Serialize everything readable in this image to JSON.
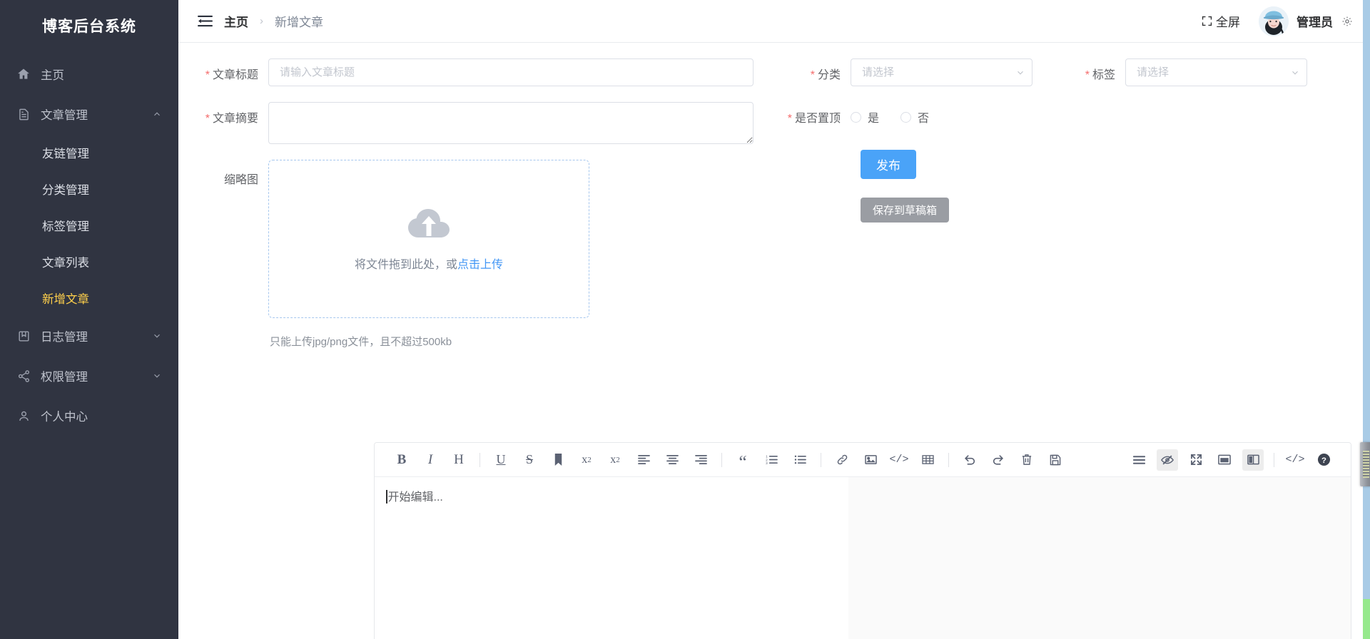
{
  "sidebar": {
    "brand": "博客后台系统",
    "items": [
      {
        "label": "主页",
        "icon": "home-icon",
        "arrow": ""
      },
      {
        "label": "文章管理",
        "icon": "document-icon",
        "arrow": "chevron-up-icon"
      },
      {
        "label": "日志管理",
        "icon": "book-icon",
        "arrow": "chevron-down-icon"
      },
      {
        "label": "权限管理",
        "icon": "share-icon",
        "arrow": "chevron-down-icon"
      },
      {
        "label": "个人中心",
        "icon": "user-icon",
        "arrow": ""
      }
    ],
    "submenu": [
      {
        "label": "友链管理",
        "active": false
      },
      {
        "label": "分类管理",
        "active": false
      },
      {
        "label": "标签管理",
        "active": false
      },
      {
        "label": "文章列表",
        "active": false
      },
      {
        "label": "新增文章",
        "active": true
      }
    ],
    "active_color": "#ffd04b",
    "background": "#303441"
  },
  "topbar": {
    "collapse_icon": "collapse-menu-icon",
    "breadcrumb_home": "主页",
    "breadcrumb_separator": "›",
    "breadcrumb_current": "新增文章",
    "fullscreen_label": "全屏",
    "fullscreen_icon": "fullscreen-icon",
    "username": "管理员",
    "gear_icon": "gear-icon",
    "avatar": "user-avatar"
  },
  "form": {
    "title": {
      "label": "文章标题",
      "required": true,
      "value": "",
      "placeholder": "请输入文章标题"
    },
    "summary": {
      "label": "文章摘要",
      "required": true,
      "value": "",
      "placeholder": ""
    },
    "category": {
      "label": "分类",
      "required": true,
      "value": "",
      "placeholder": "请选择",
      "arrow_icon": "chevron-down-icon"
    },
    "tag": {
      "label": "标签",
      "required": true,
      "value": "",
      "placeholder": "请选择",
      "arrow_icon": "chevron-down-icon"
    },
    "pin": {
      "label": "是否置顶",
      "required": true,
      "options": [
        {
          "label": "是",
          "checked": false
        },
        {
          "label": "否",
          "checked": false
        }
      ]
    },
    "thumbnail": {
      "label": "缩略图",
      "icon": "cloud-upload-icon",
      "drop_text": "将文件拖到此处，或",
      "link_text": "点击上传",
      "tip": "只能上传jpg/png文件，且不超过500kb"
    },
    "buttons": {
      "publish": "发布",
      "draft": "保存到草稿箱",
      "publish_color": "#4aa3f8",
      "draft_color": "#9a9da3"
    }
  },
  "editor": {
    "placeholder": "开始编辑...",
    "toolbar_left": [
      {
        "name": "bold-icon",
        "glyph": "B",
        "active": false,
        "sep_after": false
      },
      {
        "name": "italic-icon",
        "glyph": "I",
        "active": false,
        "sep_after": false
      },
      {
        "name": "heading-icon",
        "glyph": "H",
        "active": false,
        "sep_after": true
      },
      {
        "name": "underline-icon",
        "glyph": "U",
        "active": false,
        "sep_after": false
      },
      {
        "name": "strikethrough-icon",
        "glyph": "S",
        "active": false,
        "sep_after": false
      },
      {
        "name": "bookmark-icon",
        "glyph": "",
        "active": false,
        "sep_after": false
      },
      {
        "name": "superscript-icon",
        "glyph": "",
        "active": false,
        "sep_after": false
      },
      {
        "name": "subscript-icon",
        "glyph": "",
        "active": false,
        "sep_after": false
      },
      {
        "name": "align-left-icon",
        "glyph": "",
        "active": false,
        "sep_after": false
      },
      {
        "name": "align-center-icon",
        "glyph": "",
        "active": false,
        "sep_after": false
      },
      {
        "name": "align-right-icon",
        "glyph": "",
        "active": false,
        "sep_after": true
      },
      {
        "name": "quote-icon",
        "glyph": "",
        "active": false,
        "sep_after": false
      },
      {
        "name": "ordered-list-icon",
        "glyph": "",
        "active": false,
        "sep_after": false
      },
      {
        "name": "unordered-list-icon",
        "glyph": "",
        "active": false,
        "sep_after": true
      },
      {
        "name": "link-icon",
        "glyph": "",
        "active": false,
        "sep_after": false
      },
      {
        "name": "image-icon",
        "glyph": "",
        "active": false,
        "sep_after": false
      },
      {
        "name": "code-icon",
        "glyph": "",
        "active": false,
        "sep_after": false
      },
      {
        "name": "table-icon",
        "glyph": "",
        "active": false,
        "sep_after": true
      },
      {
        "name": "undo-icon",
        "glyph": "",
        "active": false,
        "sep_after": false
      },
      {
        "name": "redo-icon",
        "glyph": "",
        "active": false,
        "sep_after": false
      },
      {
        "name": "trash-icon",
        "glyph": "",
        "active": false,
        "sep_after": false
      },
      {
        "name": "save-icon",
        "glyph": "",
        "active": false,
        "sep_after": false
      }
    ],
    "toolbar_right": [
      {
        "name": "outline-icon",
        "active": false,
        "sep_after": false
      },
      {
        "name": "eye-slash-icon",
        "active": true,
        "sep_after": false
      },
      {
        "name": "expand-fullscreen-icon",
        "active": false,
        "sep_after": false
      },
      {
        "name": "preview-window-icon",
        "active": false,
        "sep_after": false
      },
      {
        "name": "split-view-icon",
        "active": true,
        "sep_after": true
      },
      {
        "name": "source-code-icon",
        "active": false,
        "sep_after": false
      },
      {
        "name": "help-icon",
        "active": false,
        "sep_after": false
      }
    ]
  }
}
